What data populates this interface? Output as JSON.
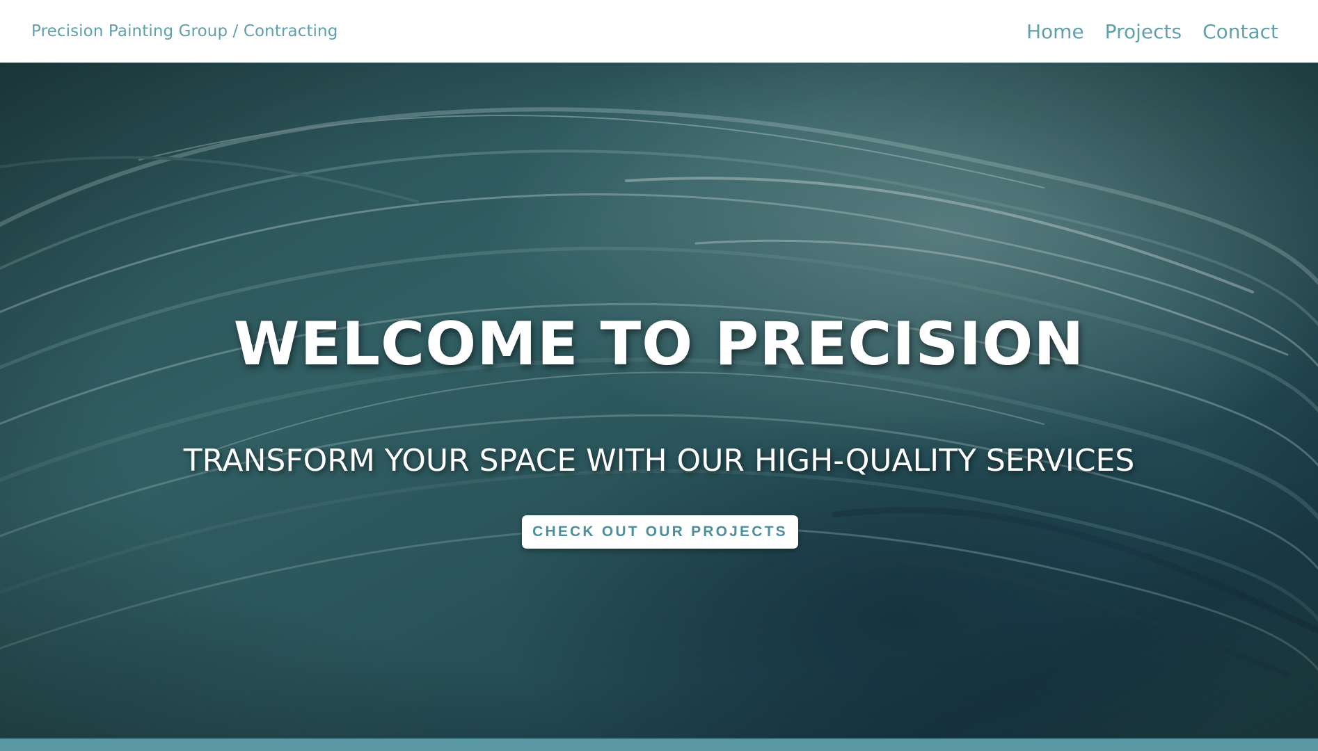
{
  "navbar": {
    "brand": "Precision Painting Group / Contracting",
    "links": [
      {
        "label": "Home"
      },
      {
        "label": "Projects"
      },
      {
        "label": "Contact"
      }
    ]
  },
  "hero": {
    "title": "WELCOME TO PRECISION",
    "subtitle": "TRANSFORM YOUR SPACE WITH OUR HIGH-QUALITY SERVICES",
    "cta_label": "CHECK OUT OUR PROJECTS",
    "background_description_colors": {
      "base": "#2f5a5f",
      "dark": "#1d3c46",
      "light": "#8fb3b4"
    }
  },
  "colors": {
    "accent": "#5fa0ab",
    "cta_text": "#4e8f9b",
    "footer_strip": "#5a98a3",
    "hero_text": "#ffffff"
  }
}
